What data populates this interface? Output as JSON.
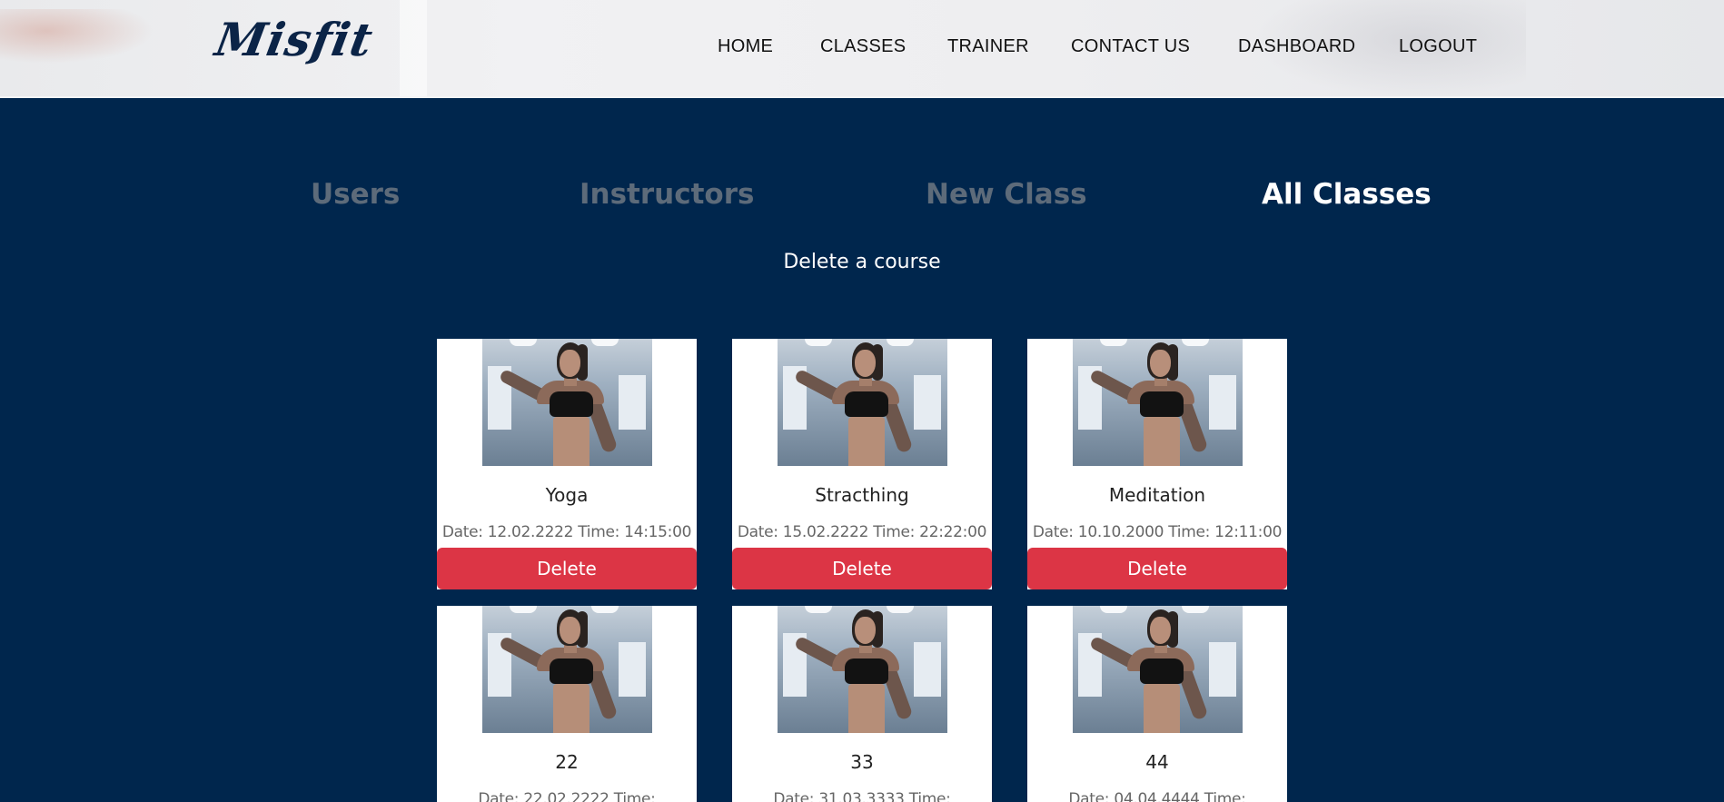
{
  "brand": {
    "logo_text": "Misfit"
  },
  "nav": {
    "items": [
      {
        "label": "HOME"
      },
      {
        "label": "CLASSES"
      },
      {
        "label": "TRAINER"
      },
      {
        "label": "CONTACT US"
      },
      {
        "label": "DASHBOARD"
      },
      {
        "label": "LOGOUT"
      }
    ]
  },
  "admin_tabs": [
    {
      "label": "Users",
      "active": false
    },
    {
      "label": "Instructors",
      "active": false
    },
    {
      "label": "New Class",
      "active": false
    },
    {
      "label": "All Classes",
      "active": true
    }
  ],
  "section_title": "Delete a course",
  "classes": [
    {
      "name": "Yoga",
      "meta": "Date: 12.02.2222 Time: 14:15:00",
      "delete_label": "Delete"
    },
    {
      "name": "Stracthing",
      "meta": "Date: 15.02.2222 Time: 22:22:00",
      "delete_label": "Delete"
    },
    {
      "name": "Meditation",
      "meta": "Date: 10.10.2000 Time: 12:11:00",
      "delete_label": "Delete"
    },
    {
      "name": "22",
      "meta": "Date: 22.02.2222 Time:"
    },
    {
      "name": "33",
      "meta": "Date: 31.03.3333 Time:"
    },
    {
      "name": "44",
      "meta": "Date: 04.04.4444 Time:"
    }
  ],
  "colors": {
    "page_background": "#00264d",
    "delete_button": "#dc3545",
    "tab_inactive": "#5d6b7a",
    "tab_active": "#ffffff"
  }
}
